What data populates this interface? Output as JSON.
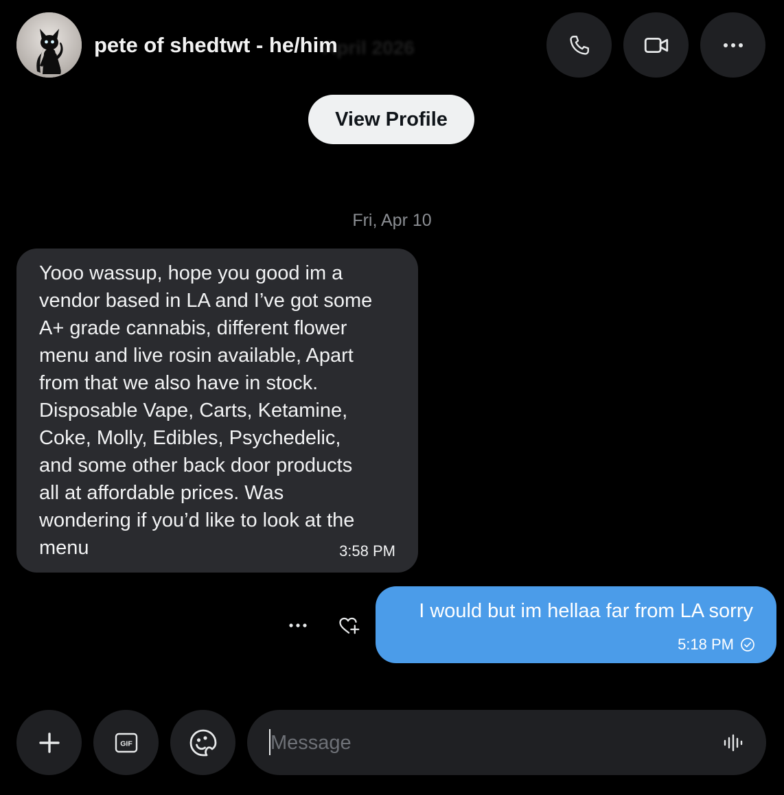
{
  "header": {
    "contact_name": "pete of shedtwt - he/him",
    "blurred_text": "April 2026",
    "avatar_icon": "black-cat-avatar-icon",
    "call_icon": "phone-icon",
    "video_icon": "video-camera-icon",
    "more_icon": "more-horizontal-icon"
  },
  "profile": {
    "view_profile_label": "View Profile"
  },
  "conversation": {
    "date_separator": "Fri, Apr 10",
    "messages": [
      {
        "direction": "incoming",
        "text": "Yooo wassup, hope you good im a\nvendor based in LA and I’ve got some\nA+ grade cannabis, different flower\nmenu and live rosin available, Apart\nfrom that we also have in stock.\nDisposable Vape,  Carts, Ketamine,\nCoke, Molly, Edibles, Psychedelic,\nand some other back door products\nall at affordable prices. Was\nwondering if you’d like to look at the\nmenu",
        "time": "3:58 PM"
      },
      {
        "direction": "outgoing",
        "text": "I would but im hellaa far from LA sorry",
        "time": "5:18 PM",
        "status_icon": "read-check-circle-icon"
      }
    ],
    "message_actions": {
      "more_icon": "more-horizontal-icon",
      "react_icon": "heart-plus-icon"
    }
  },
  "composer": {
    "add_icon": "plus-icon",
    "gif_label": "GIF",
    "emoji_icon": "emoji-icon",
    "input_placeholder": "Message",
    "input_value": "",
    "voice_icon": "voice-waveform-icon"
  },
  "colors": {
    "background": "#000000",
    "incoming_bubble": "#2a2b2f",
    "outgoing_bubble": "#4b9ce9",
    "button_background": "#1f2023",
    "view_profile_background": "#eff1f2",
    "muted_text": "#8b8e93"
  }
}
